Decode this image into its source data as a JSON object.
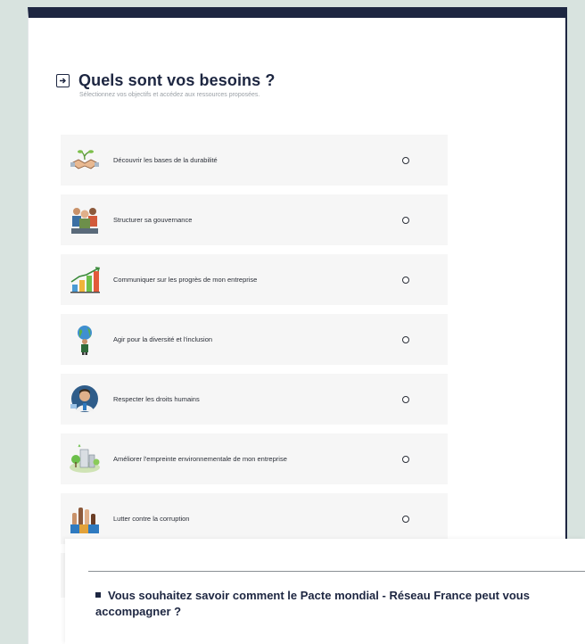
{
  "header": {
    "title": "Quels sont vos besoins ?",
    "subtitle": "Sélectionnez vos objectifs et accédez aux ressources proposées."
  },
  "options": [
    {
      "label": "Découvrir les bases de la durabilité",
      "icon": "handshake-plant-icon"
    },
    {
      "label": "Structurer sa gouvernance",
      "icon": "team-icon"
    },
    {
      "label": "Communiquer sur les progrès de mon entreprise",
      "icon": "growth-chart-icon"
    },
    {
      "label": "Agir pour la diversité et l'inclusion",
      "icon": "globe-people-icon"
    },
    {
      "label": "Respecter les droits humains",
      "icon": "human-rights-icon"
    },
    {
      "label": "Améliorer l'empreinte environnementale de mon entreprise",
      "icon": "green-city-icon"
    },
    {
      "label": "Lutter contre la corruption",
      "icon": "raised-hands-icon"
    }
  ],
  "popup": {
    "text": "Vous souhaitez savoir comment le Pacte mondial - Réseau France peut vous accompagner ?"
  },
  "colors": {
    "background": "#d8e3df",
    "navy": "#1d2641",
    "option_bg": "#f6f6f6"
  }
}
